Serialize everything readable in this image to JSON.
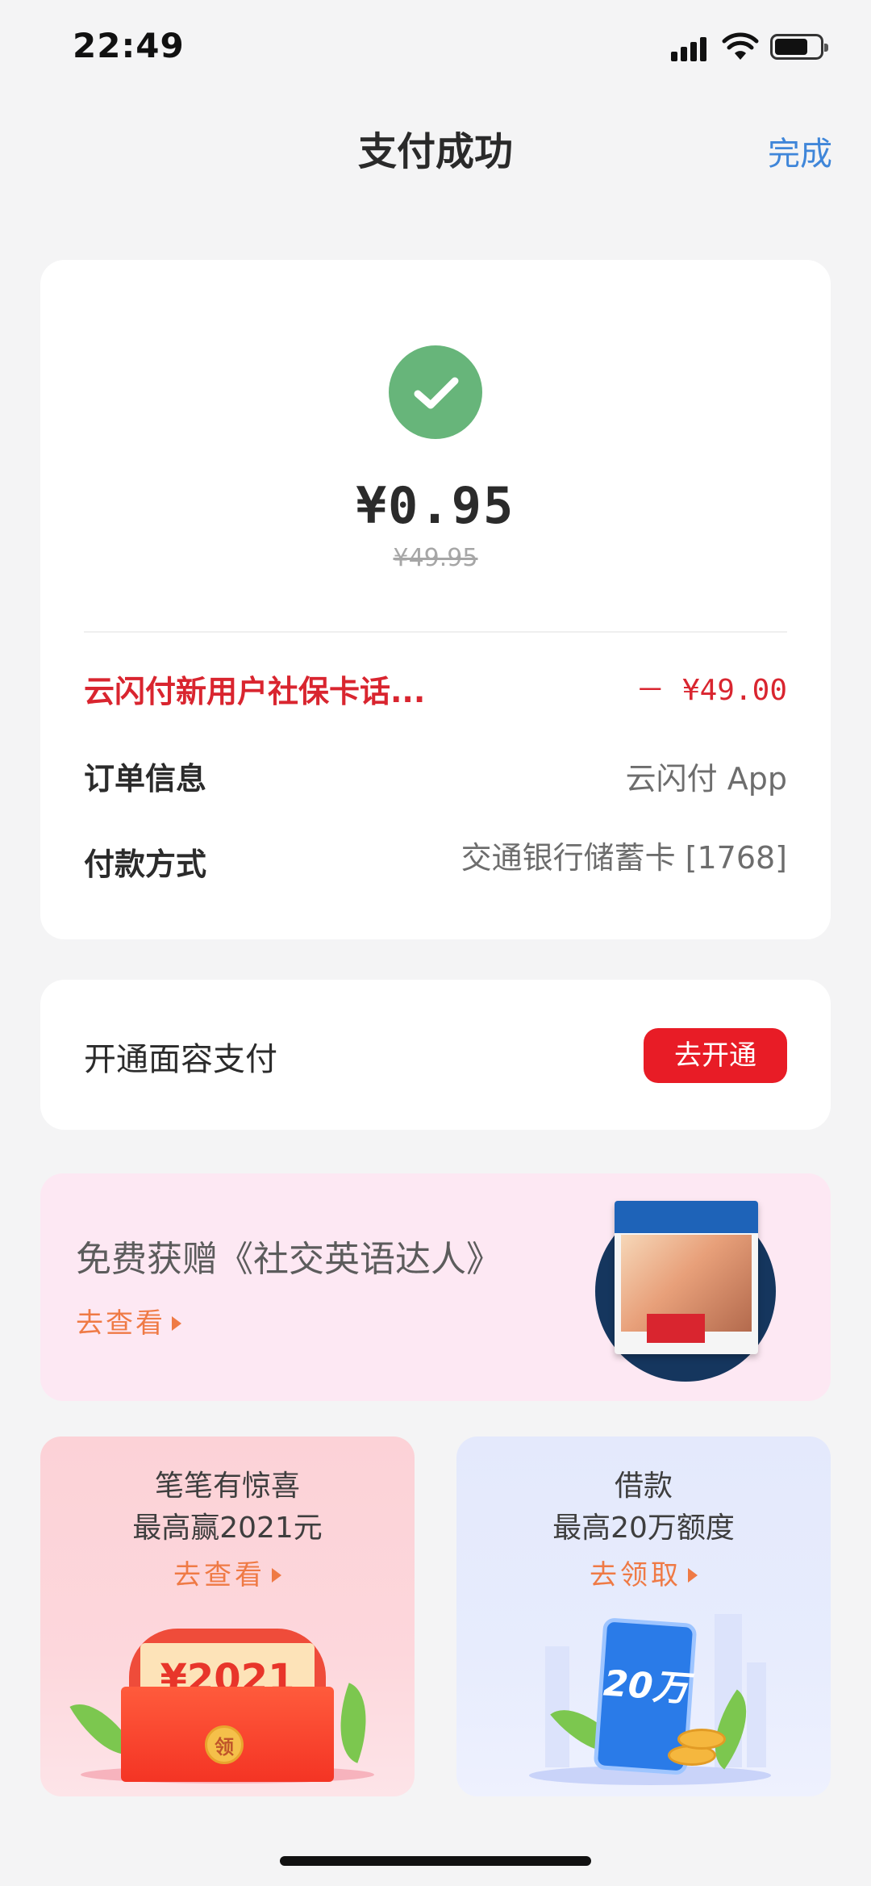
{
  "status_bar": {
    "time": "22:49"
  },
  "nav": {
    "title": "支付成功",
    "done_label": "完成"
  },
  "payment": {
    "amount": "¥0.95",
    "original_amount": "¥49.95",
    "promo_label": "云闪付新用户社保卡话...",
    "promo_value": "－ ¥49.00",
    "order_label": "订单信息",
    "order_value": "云闪付 App",
    "method_label": "付款方式",
    "method_value": "交通银行储蓄卡 [1768]"
  },
  "face_pay": {
    "label": "开通面容支付",
    "button": "去开通"
  },
  "banner": {
    "title": "免费获赠《社交英语达人》",
    "link": "去查看"
  },
  "tiles": [
    {
      "line1": "笔笔有惊喜",
      "line2": "最高赢2021元",
      "link": "去查看",
      "illustration_text": "¥2021",
      "coin_text": "领"
    },
    {
      "line1": "借款",
      "line2": "最高20万额度",
      "link": "去领取",
      "illustration_text": "20万"
    }
  ],
  "colors": {
    "accent_blue": "#3f86d9",
    "promo_red": "#d9252f",
    "button_red": "#e81c26",
    "success_green": "#67b57a",
    "link_orange": "#ef7a45"
  },
  "icons": [
    "signal-icon",
    "wifi-icon",
    "battery-icon",
    "check-icon",
    "arrow-right-icon"
  ]
}
